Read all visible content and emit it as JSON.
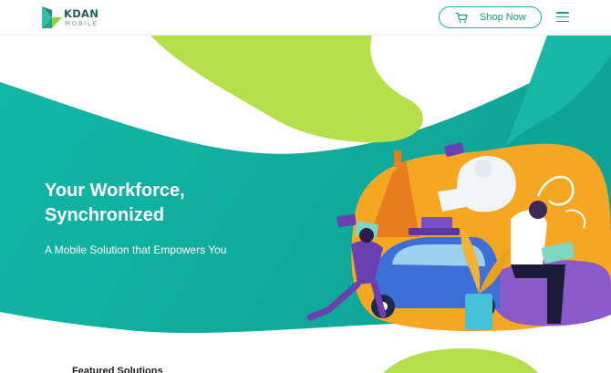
{
  "header": {
    "logo": {
      "brand": "KDAN",
      "sub": "MOBILE"
    },
    "shop_button": {
      "label": "Shop Now",
      "icon": "cart-icon"
    },
    "menu_icon": "hamburger-menu-icon"
  },
  "hero": {
    "headline_line1": "Your Workforce,",
    "headline_line2": "Synchronized",
    "subheadline": "A Mobile Solution that Empowers You",
    "illustration": "workforce-illustration"
  },
  "sections": {
    "featured_title": "Featured Solutions"
  },
  "colors": {
    "teal": "#13b5a6",
    "teal_dark": "#0fa69a",
    "lime": "#b5e04b",
    "orange": "#f5a623",
    "purple": "#6a3fb0",
    "accent_text": "#149d92"
  }
}
